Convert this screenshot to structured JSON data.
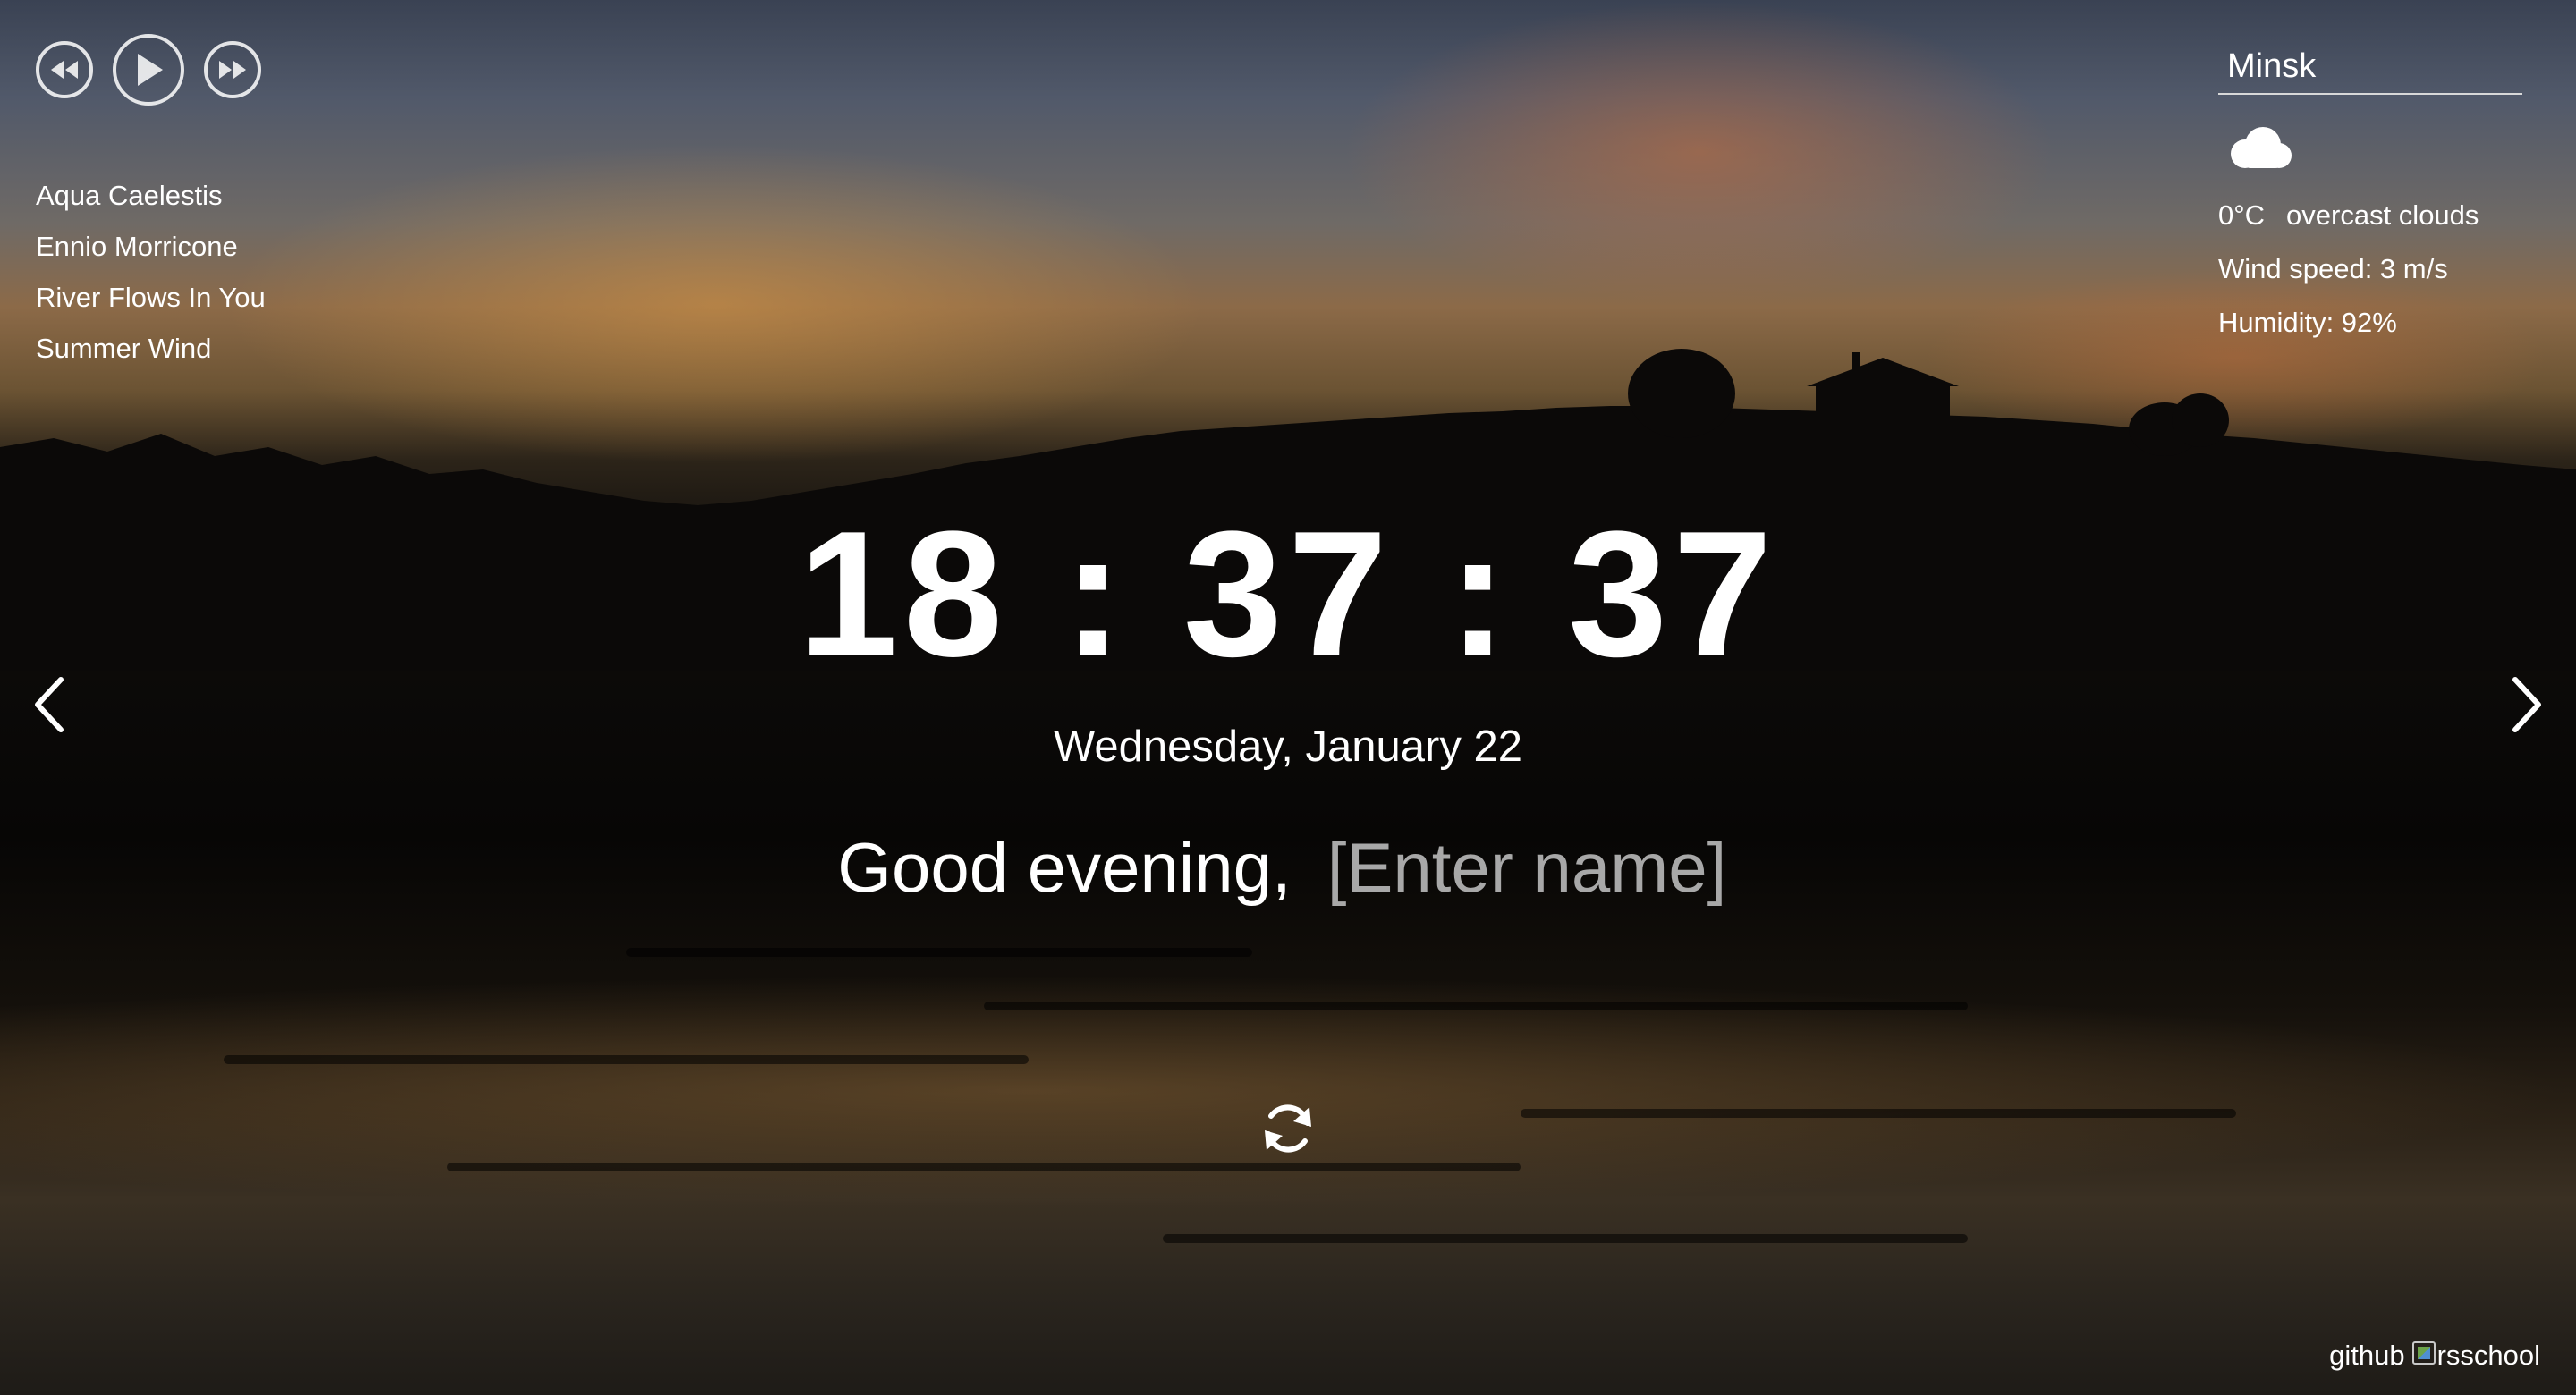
{
  "player": {
    "controls": [
      {
        "name": "play-prev-icon"
      },
      {
        "name": "play-icon"
      },
      {
        "name": "play-next-icon"
      }
    ],
    "playlist": [
      "Aqua Caelestis",
      "Ennio Morricone",
      "River Flows In You",
      "Summer Wind"
    ]
  },
  "weather": {
    "city": "Minsk",
    "icon": "cloud-icon",
    "temperature": "0°C",
    "description": "overcast clouds",
    "wind": "Wind speed: 3 m/s",
    "humidity": "Humidity: 92%"
  },
  "clock": {
    "time": "18:37:37",
    "date": "Wednesday, January 22"
  },
  "greeting": {
    "text": "Good evening,",
    "name_placeholder": "[Enter name]"
  },
  "controls": {
    "slide_prev_icon": "chevron-left-icon",
    "slide_next_icon": "chevron-right-icon",
    "change_quote_icon": "refresh-icon"
  },
  "footer": {
    "github_label": "github",
    "rsschool_label": "rsschool"
  },
  "colors": {
    "text": "#ffffff",
    "placeholder": "#a8a8a8",
    "sunset_orange": "#d6964a"
  }
}
